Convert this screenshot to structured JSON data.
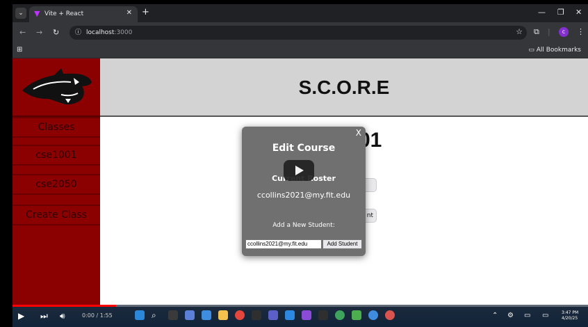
{
  "browser": {
    "tab_title": "Vite + React",
    "url_host": "localhost",
    "url_port": ":3000",
    "bookmarks_label": "All Bookmarks",
    "profile_letter": "c"
  },
  "app": {
    "title": "S.C.O.R.E",
    "sidebar": {
      "items": [
        {
          "label": "Classes"
        },
        {
          "label": "cse1001"
        },
        {
          "label": "cse2050"
        },
        {
          "label": "Create Class"
        }
      ]
    },
    "main": {
      "course_title_visible": "01",
      "partial_button_text": "nt"
    },
    "modal": {
      "close_label": "X",
      "title": "Edit Course",
      "roster_label": "Current Roster",
      "roster_email": "ccollins2021@my.fit.edu",
      "add_label": "Add a New Student:",
      "input_value": "ccollins2021@my.fit.edu",
      "add_button": "Add Student"
    }
  },
  "video": {
    "time": "0:00 / 1:55",
    "progress": 0.18,
    "clock_time": "3:47 PM",
    "clock_date": "4/20/25"
  },
  "colors": {
    "sidebar": "#8b0000",
    "header": "#d3d3d3",
    "modal": "#707070"
  }
}
